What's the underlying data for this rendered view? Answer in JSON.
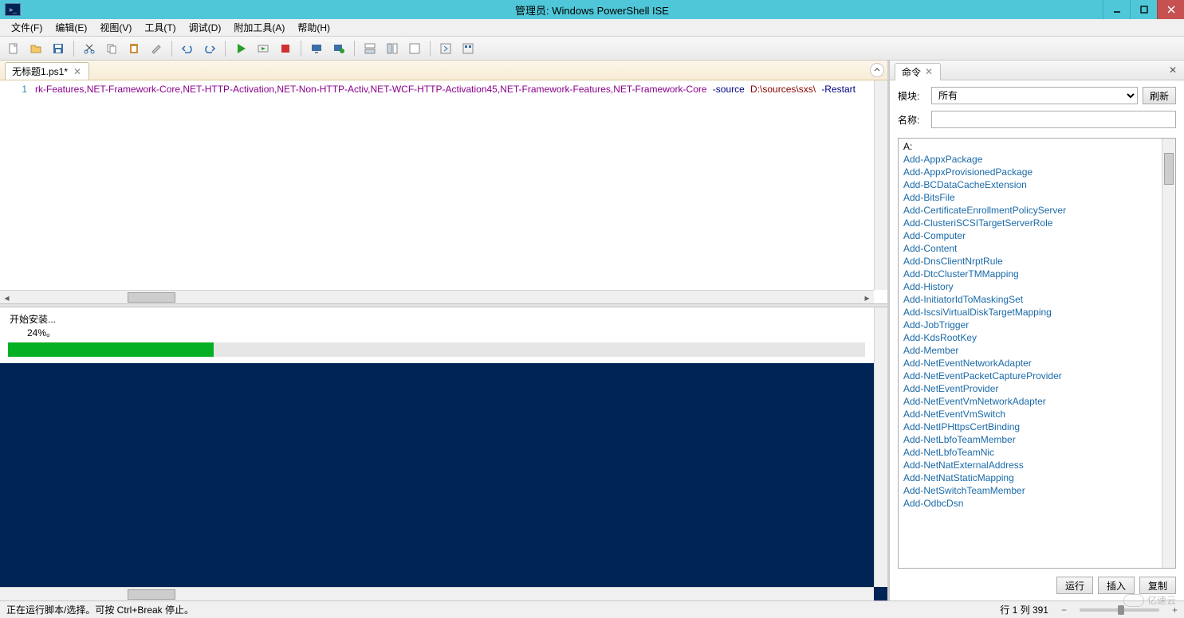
{
  "window": {
    "title": "管理员: Windows PowerShell ISE"
  },
  "menu": {
    "file": "文件(F)",
    "edit": "编辑(E)",
    "view": "视图(V)",
    "tools": "工具(T)",
    "debug": "调试(D)",
    "addons": "附加工具(A)",
    "help": "帮助(H)"
  },
  "tab": {
    "title": "无标题1.ps1*"
  },
  "editor": {
    "line_number": "1",
    "code_prefix": "rk-Features,",
    "code_args": "NET-Framework-Core,NET-HTTP-Activation,NET-Non-HTTP-Activ,NET-WCF-HTTP-Activation45,NET-Framework-Features,NET-Framework-Core",
    "code_param1": "-source",
    "code_path": "D:\\sources\\sxs\\",
    "code_param2": "-Restart"
  },
  "progress": {
    "label": "开始安装...",
    "percent_text": "24%。",
    "percent": 24
  },
  "commands_pane": {
    "tab_label": "命令",
    "module_label": "模块:",
    "module_value": "所有",
    "refresh": "刷新",
    "name_label": "名称:",
    "group_a": "A:",
    "list": [
      "Add-AppxPackage",
      "Add-AppxProvisionedPackage",
      "Add-BCDataCacheExtension",
      "Add-BitsFile",
      "Add-CertificateEnrollmentPolicyServer",
      "Add-ClusteriSCSITargetServerRole",
      "Add-Computer",
      "Add-Content",
      "Add-DnsClientNrptRule",
      "Add-DtcClusterTMMapping",
      "Add-History",
      "Add-InitiatorIdToMaskingSet",
      "Add-IscsiVirtualDiskTargetMapping",
      "Add-JobTrigger",
      "Add-KdsRootKey",
      "Add-Member",
      "Add-NetEventNetworkAdapter",
      "Add-NetEventPacketCaptureProvider",
      "Add-NetEventProvider",
      "Add-NetEventVmNetworkAdapter",
      "Add-NetEventVmSwitch",
      "Add-NetIPHttpsCertBinding",
      "Add-NetLbfoTeamMember",
      "Add-NetLbfoTeamNic",
      "Add-NetNatExternalAddress",
      "Add-NetNatStaticMapping",
      "Add-NetSwitchTeamMember",
      "Add-OdbcDsn"
    ],
    "run": "运行",
    "insert": "插入",
    "copy": "复制"
  },
  "status": {
    "message": "正在运行脚本/选择。可按 Ctrl+Break 停止。",
    "position": "行 1 列 391"
  },
  "watermark": "亿速云"
}
